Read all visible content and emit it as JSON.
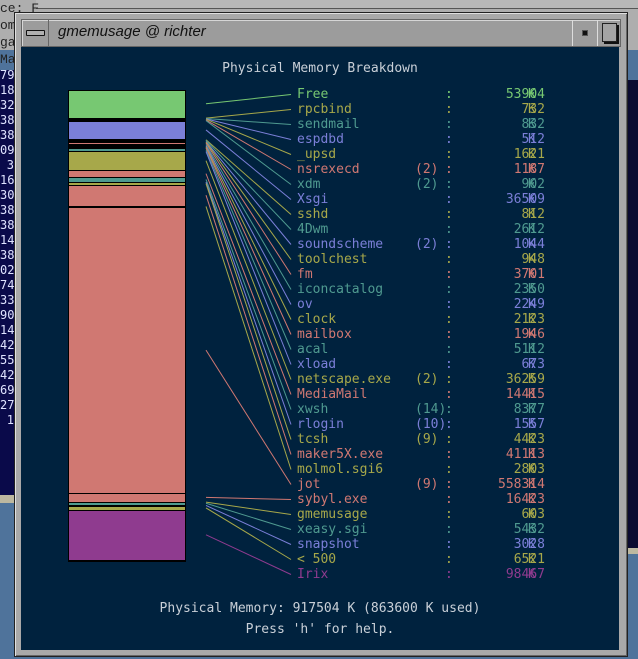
{
  "background": {
    "left_terminal_lines": [
      "ce: F",
      "om",
      "ga",
      "Ma"
    ],
    "left_column_numbers": [
      "79",
      "18",
      "32",
      "38",
      "38",
      "09",
      "3",
      "16",
      "30",
      "38",
      "38",
      "14",
      "38",
      "02",
      "74",
      "33",
      "90",
      "14",
      "42",
      "55",
      "42",
      "69",
      "27",
      "1"
    ]
  },
  "window": {
    "title": "gmemusage @ richter",
    "heading": "Physical Memory Breakdown",
    "footer_memory": "Physical Memory: 917504 K (863600 K used)",
    "footer_help": "Press 'h' for help."
  },
  "colors": {
    "background": "#00223e",
    "green": "#77c872",
    "olive": "#a7a84a",
    "teal": "#4f9a90",
    "blue": "#7b7fd8",
    "salmon": "#d07872",
    "purple": "#8f3b8f",
    "text": "#c9d0d8"
  },
  "chart_data": {
    "type": "bar",
    "title": "Physical Memory Breakdown",
    "unit": "K",
    "total": 917504,
    "used": 863600,
    "processes": [
      {
        "name": "Free",
        "count": "",
        "value": 53904,
        "color": "#77c872"
      },
      {
        "name": "rpcbind",
        "count": "",
        "value": 732,
        "color": "#a7a84a"
      },
      {
        "name": "sendmail",
        "count": "",
        "value": 832,
        "color": "#4f9a90"
      },
      {
        "name": "espdbd",
        "count": "",
        "value": 512,
        "color": "#7b7fd8"
      },
      {
        "name": "_upsd",
        "count": "",
        "value": 1621,
        "color": "#a7a84a"
      },
      {
        "name": "nsrexecd",
        "count": "(2)",
        "value": 1187,
        "color": "#d07872"
      },
      {
        "name": "xdm",
        "count": "(2)",
        "value": 902,
        "color": "#4f9a90"
      },
      {
        "name": "Xsgi",
        "count": "",
        "value": 36509,
        "color": "#7b7fd8"
      },
      {
        "name": "sshd",
        "count": "",
        "value": 812,
        "color": "#a7a84a"
      },
      {
        "name": "4Dwm",
        "count": "",
        "value": 2612,
        "color": "#4f9a90"
      },
      {
        "name": "soundscheme",
        "count": "(2)",
        "value": 1044,
        "color": "#7b7fd8"
      },
      {
        "name": "toolchest",
        "count": "",
        "value": 948,
        "color": "#a7a84a"
      },
      {
        "name": "fm",
        "count": "",
        "value": 3701,
        "color": "#d07872"
      },
      {
        "name": "iconcatalog",
        "count": "",
        "value": 2350,
        "color": "#4f9a90"
      },
      {
        "name": "ov",
        "count": "",
        "value": 2249,
        "color": "#7b7fd8"
      },
      {
        "name": "clock",
        "count": "",
        "value": 2123,
        "color": "#a7a84a"
      },
      {
        "name": "mailbox",
        "count": "",
        "value": 1946,
        "color": "#d07872"
      },
      {
        "name": "acal",
        "count": "",
        "value": 5112,
        "color": "#4f9a90"
      },
      {
        "name": "xload",
        "count": "",
        "value": 673,
        "color": "#7b7fd8"
      },
      {
        "name": "netscape.exe",
        "count": "(2)",
        "value": 36259,
        "color": "#a7a84a"
      },
      {
        "name": "MediaMail",
        "count": "",
        "value": 14415,
        "color": "#d07872"
      },
      {
        "name": "xwsh",
        "count": "(14)",
        "value": 8377,
        "color": "#4f9a90"
      },
      {
        "name": "rlogin",
        "count": "(10)",
        "value": 1557,
        "color": "#7b7fd8"
      },
      {
        "name": "tcsh",
        "count": "(9)",
        "value": 4423,
        "color": "#a7a84a"
      },
      {
        "name": "maker5X.exe",
        "count": "",
        "value": 41113,
        "color": "#d07872"
      },
      {
        "name": "molmol.sgi6",
        "count": "",
        "value": 2803,
        "color": "#a7a84a"
      },
      {
        "name": "jot",
        "count": "(9)",
        "value": 558314,
        "color": "#d07872"
      },
      {
        "name": "sybyl.exe",
        "count": "",
        "value": 16423,
        "color": "#d07872"
      },
      {
        "name": "gmemusage",
        "count": "",
        "value": 603,
        "color": "#a7a84a"
      },
      {
        "name": "xeasy.sgi",
        "count": "",
        "value": 5432,
        "color": "#4f9a90"
      },
      {
        "name": "snapshot",
        "count": "",
        "value": 3028,
        "color": "#7b7fd8"
      },
      {
        "name": "< 500",
        "count": "",
        "value": 6521,
        "color": "#a7a84a"
      },
      {
        "name": "Irix",
        "count": "",
        "value": 98467,
        "color": "#8f3b8f"
      }
    ]
  }
}
